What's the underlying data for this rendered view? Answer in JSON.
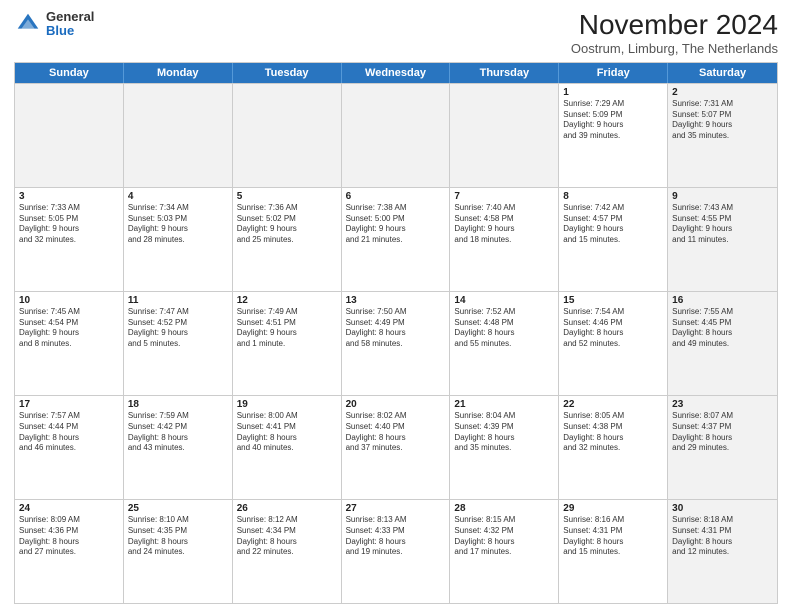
{
  "logo": {
    "general": "General",
    "blue": "Blue"
  },
  "title": "November 2024",
  "subtitle": "Oostrum, Limburg, The Netherlands",
  "header_days": [
    "Sunday",
    "Monday",
    "Tuesday",
    "Wednesday",
    "Thursday",
    "Friday",
    "Saturday"
  ],
  "weeks": [
    [
      {
        "day": "",
        "info": "",
        "shaded": true
      },
      {
        "day": "",
        "info": "",
        "shaded": true
      },
      {
        "day": "",
        "info": "",
        "shaded": true
      },
      {
        "day": "",
        "info": "",
        "shaded": true
      },
      {
        "day": "",
        "info": "",
        "shaded": true
      },
      {
        "day": "1",
        "info": "Sunrise: 7:29 AM\nSunset: 5:09 PM\nDaylight: 9 hours\nand 39 minutes.",
        "shaded": false
      },
      {
        "day": "2",
        "info": "Sunrise: 7:31 AM\nSunset: 5:07 PM\nDaylight: 9 hours\nand 35 minutes.",
        "shaded": true
      }
    ],
    [
      {
        "day": "3",
        "info": "Sunrise: 7:33 AM\nSunset: 5:05 PM\nDaylight: 9 hours\nand 32 minutes.",
        "shaded": false
      },
      {
        "day": "4",
        "info": "Sunrise: 7:34 AM\nSunset: 5:03 PM\nDaylight: 9 hours\nand 28 minutes.",
        "shaded": false
      },
      {
        "day": "5",
        "info": "Sunrise: 7:36 AM\nSunset: 5:02 PM\nDaylight: 9 hours\nand 25 minutes.",
        "shaded": false
      },
      {
        "day": "6",
        "info": "Sunrise: 7:38 AM\nSunset: 5:00 PM\nDaylight: 9 hours\nand 21 minutes.",
        "shaded": false
      },
      {
        "day": "7",
        "info": "Sunrise: 7:40 AM\nSunset: 4:58 PM\nDaylight: 9 hours\nand 18 minutes.",
        "shaded": false
      },
      {
        "day": "8",
        "info": "Sunrise: 7:42 AM\nSunset: 4:57 PM\nDaylight: 9 hours\nand 15 minutes.",
        "shaded": false
      },
      {
        "day": "9",
        "info": "Sunrise: 7:43 AM\nSunset: 4:55 PM\nDaylight: 9 hours\nand 11 minutes.",
        "shaded": true
      }
    ],
    [
      {
        "day": "10",
        "info": "Sunrise: 7:45 AM\nSunset: 4:54 PM\nDaylight: 9 hours\nand 8 minutes.",
        "shaded": false
      },
      {
        "day": "11",
        "info": "Sunrise: 7:47 AM\nSunset: 4:52 PM\nDaylight: 9 hours\nand 5 minutes.",
        "shaded": false
      },
      {
        "day": "12",
        "info": "Sunrise: 7:49 AM\nSunset: 4:51 PM\nDaylight: 9 hours\nand 1 minute.",
        "shaded": false
      },
      {
        "day": "13",
        "info": "Sunrise: 7:50 AM\nSunset: 4:49 PM\nDaylight: 8 hours\nand 58 minutes.",
        "shaded": false
      },
      {
        "day": "14",
        "info": "Sunrise: 7:52 AM\nSunset: 4:48 PM\nDaylight: 8 hours\nand 55 minutes.",
        "shaded": false
      },
      {
        "day": "15",
        "info": "Sunrise: 7:54 AM\nSunset: 4:46 PM\nDaylight: 8 hours\nand 52 minutes.",
        "shaded": false
      },
      {
        "day": "16",
        "info": "Sunrise: 7:55 AM\nSunset: 4:45 PM\nDaylight: 8 hours\nand 49 minutes.",
        "shaded": true
      }
    ],
    [
      {
        "day": "17",
        "info": "Sunrise: 7:57 AM\nSunset: 4:44 PM\nDaylight: 8 hours\nand 46 minutes.",
        "shaded": false
      },
      {
        "day": "18",
        "info": "Sunrise: 7:59 AM\nSunset: 4:42 PM\nDaylight: 8 hours\nand 43 minutes.",
        "shaded": false
      },
      {
        "day": "19",
        "info": "Sunrise: 8:00 AM\nSunset: 4:41 PM\nDaylight: 8 hours\nand 40 minutes.",
        "shaded": false
      },
      {
        "day": "20",
        "info": "Sunrise: 8:02 AM\nSunset: 4:40 PM\nDaylight: 8 hours\nand 37 minutes.",
        "shaded": false
      },
      {
        "day": "21",
        "info": "Sunrise: 8:04 AM\nSunset: 4:39 PM\nDaylight: 8 hours\nand 35 minutes.",
        "shaded": false
      },
      {
        "day": "22",
        "info": "Sunrise: 8:05 AM\nSunset: 4:38 PM\nDaylight: 8 hours\nand 32 minutes.",
        "shaded": false
      },
      {
        "day": "23",
        "info": "Sunrise: 8:07 AM\nSunset: 4:37 PM\nDaylight: 8 hours\nand 29 minutes.",
        "shaded": true
      }
    ],
    [
      {
        "day": "24",
        "info": "Sunrise: 8:09 AM\nSunset: 4:36 PM\nDaylight: 8 hours\nand 27 minutes.",
        "shaded": false
      },
      {
        "day": "25",
        "info": "Sunrise: 8:10 AM\nSunset: 4:35 PM\nDaylight: 8 hours\nand 24 minutes.",
        "shaded": false
      },
      {
        "day": "26",
        "info": "Sunrise: 8:12 AM\nSunset: 4:34 PM\nDaylight: 8 hours\nand 22 minutes.",
        "shaded": false
      },
      {
        "day": "27",
        "info": "Sunrise: 8:13 AM\nSunset: 4:33 PM\nDaylight: 8 hours\nand 19 minutes.",
        "shaded": false
      },
      {
        "day": "28",
        "info": "Sunrise: 8:15 AM\nSunset: 4:32 PM\nDaylight: 8 hours\nand 17 minutes.",
        "shaded": false
      },
      {
        "day": "29",
        "info": "Sunrise: 8:16 AM\nSunset: 4:31 PM\nDaylight: 8 hours\nand 15 minutes.",
        "shaded": false
      },
      {
        "day": "30",
        "info": "Sunrise: 8:18 AM\nSunset: 4:31 PM\nDaylight: 8 hours\nand 12 minutes.",
        "shaded": true
      }
    ]
  ]
}
